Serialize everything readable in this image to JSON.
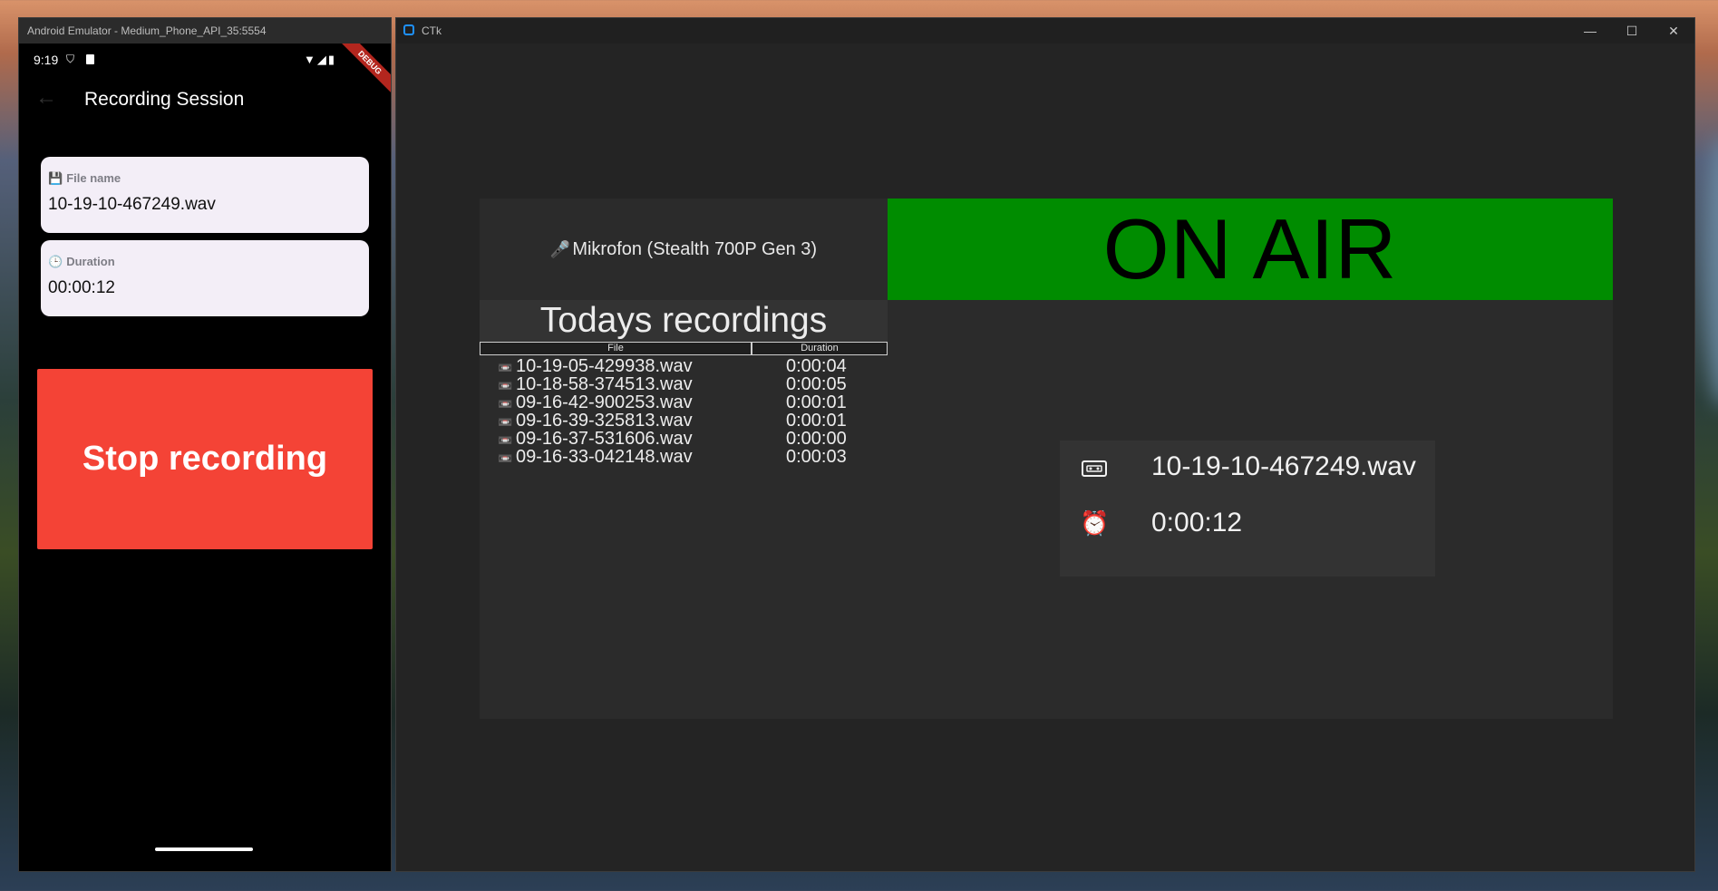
{
  "emulator": {
    "window_title": "Android Emulator - Medium_Phone_API_35:5554",
    "status_time": "9:19",
    "debug_badge": "DEBUG",
    "app_title": "Recording Session",
    "file_card": {
      "label": "File name",
      "value": "10-19-10-467249.wav",
      "icon": "floppy-disk-icon"
    },
    "duration_card": {
      "label": "Duration",
      "value": "00:00:12",
      "icon": "clock-icon"
    },
    "stop_button_label": "Stop recording",
    "colors": {
      "stop_button": "#f44336",
      "card": "#f3eef7"
    }
  },
  "ctk": {
    "window_title": "CTk",
    "microphone_label": "Mikrofon (Stealth 700P Gen 3)",
    "on_air_label": "ON AIR",
    "recordings_heading": "Todays recordings",
    "columns": [
      "File",
      "Duration"
    ],
    "recordings": [
      {
        "file": "10-19-05-429938.wav",
        "duration": "0:00:04"
      },
      {
        "file": "10-18-58-374513.wav",
        "duration": "0:00:05"
      },
      {
        "file": "09-16-42-900253.wav",
        "duration": "0:00:01"
      },
      {
        "file": "09-16-39-325813.wav",
        "duration": "0:00:01"
      },
      {
        "file": "09-16-37-531606.wav",
        "duration": "0:00:00"
      },
      {
        "file": "09-16-33-042148.wav",
        "duration": "0:00:03"
      }
    ],
    "current": {
      "file": "10-19-10-467249.wav",
      "elapsed": "0:00:12"
    },
    "colors": {
      "on_air": "#008c00",
      "background": "#242424",
      "panel": "#2b2b2b"
    }
  }
}
